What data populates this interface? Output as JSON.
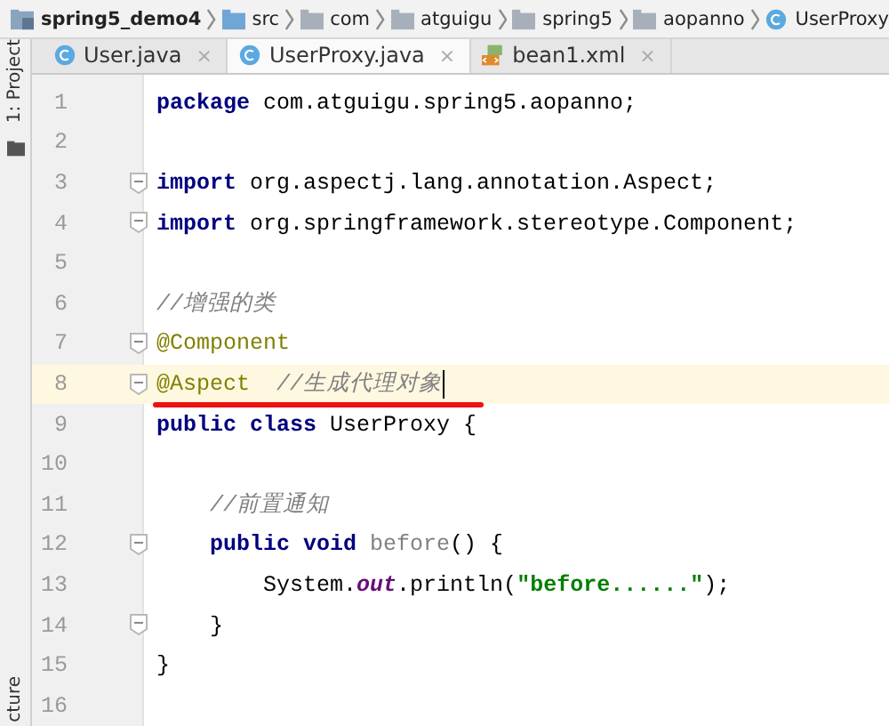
{
  "breadcrumb": [
    {
      "label": "spring5_demo4",
      "kind": "project"
    },
    {
      "label": "src",
      "kind": "folder"
    },
    {
      "label": "com",
      "kind": "folder"
    },
    {
      "label": "atguigu",
      "kind": "folder"
    },
    {
      "label": "spring5",
      "kind": "folder"
    },
    {
      "label": "aopanno",
      "kind": "folder"
    },
    {
      "label": "UserProxy",
      "kind": "class"
    }
  ],
  "side_panel": {
    "top_label": "1: Project",
    "bottom_label": "cture"
  },
  "tabs": [
    {
      "label": "User.java",
      "kind": "class",
      "selected": false,
      "close": "×"
    },
    {
      "label": "UserProxy.java",
      "kind": "class",
      "selected": true,
      "close": "×"
    },
    {
      "label": "bean1.xml",
      "kind": "xml",
      "selected": false,
      "close": "×"
    }
  ],
  "editor": {
    "lines": [
      {
        "number": "1",
        "fold": false,
        "current": false,
        "marked": false,
        "tokens": [
          {
            "text": "package",
            "kind": "keyword"
          },
          {
            "text": " com.atguigu.spring5.aopanno;",
            "kind": "plain"
          }
        ]
      },
      {
        "number": "2",
        "fold": false,
        "current": false,
        "marked": false
      },
      {
        "number": "3",
        "fold": true,
        "current": false,
        "marked": false,
        "tokens": [
          {
            "text": "import",
            "kind": "keyword"
          },
          {
            "text": " org.aspectj.lang.annotation.Aspect;",
            "kind": "plain"
          }
        ]
      },
      {
        "number": "4",
        "fold": true,
        "current": false,
        "marked": false,
        "tokens": [
          {
            "text": "import",
            "kind": "keyword"
          },
          {
            "text": " org.springframework.stereotype.Component;",
            "kind": "plain"
          }
        ]
      },
      {
        "number": "5",
        "fold": false,
        "current": false,
        "marked": false
      },
      {
        "number": "6",
        "fold": false,
        "current": false,
        "marked": false,
        "tokens": [
          {
            "text": "//增强的类",
            "kind": "comment"
          }
        ]
      },
      {
        "number": "7",
        "fold": true,
        "current": false,
        "marked": false,
        "tokens": [
          {
            "text": "@Component",
            "kind": "annotation"
          }
        ]
      },
      {
        "number": "8",
        "fold": true,
        "current": true,
        "marked": true,
        "tokens": [
          {
            "text": "@Aspect",
            "kind": "annotation"
          },
          {
            "text": "  //生成代理对象",
            "kind": "comment"
          }
        ]
      },
      {
        "number": "9",
        "fold": false,
        "current": false,
        "marked": false,
        "tokens": [
          {
            "text": "public class",
            "kind": "keyword"
          },
          {
            "text": " UserProxy {",
            "kind": "plain"
          }
        ]
      },
      {
        "number": "10",
        "fold": false,
        "current": false,
        "marked": false
      },
      {
        "number": "11",
        "fold": false,
        "current": false,
        "marked": false,
        "tokens": [
          {
            "text": "    //前置通知",
            "kind": "comment"
          }
        ]
      },
      {
        "number": "12",
        "fold": true,
        "current": false,
        "marked": false,
        "tokens": [
          {
            "text": "    public void",
            "kind": "keyword"
          },
          {
            "text": " before",
            "kind": "unused"
          },
          {
            "text": "() {",
            "kind": "plain"
          }
        ]
      },
      {
        "number": "13",
        "fold": false,
        "current": false,
        "marked": false,
        "tokens": [
          {
            "text": "        System.",
            "kind": "plain"
          },
          {
            "text": "out",
            "kind": "static"
          },
          {
            "text": ".println(",
            "kind": "plain"
          },
          {
            "text": "\"before......\"",
            "kind": "string"
          },
          {
            "text": ");",
            "kind": "plain"
          }
        ]
      },
      {
        "number": "14",
        "fold": true,
        "current": false,
        "marked": false,
        "tokens": [
          {
            "text": "    }",
            "kind": "plain"
          }
        ]
      },
      {
        "number": "15",
        "fold": false,
        "current": false,
        "marked": false,
        "tokens": [
          {
            "text": "}",
            "kind": "plain"
          }
        ]
      },
      {
        "number": "16",
        "fold": false,
        "current": false,
        "marked": false
      }
    ]
  }
}
